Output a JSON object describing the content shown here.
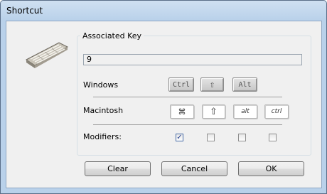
{
  "window": {
    "title": "Shortcut"
  },
  "group": {
    "label": "Associated Key"
  },
  "associated_key": {
    "value": "9"
  },
  "rows": {
    "windows": "Windows",
    "macintosh": "Macintosh",
    "modifiers": "Modifiers:"
  },
  "windows_keys": {
    "ctrl": "Ctrl",
    "shift": "⇧",
    "alt": "Alt"
  },
  "mac_keys": {
    "command": "⌘",
    "shift": "⇧",
    "option": "alt",
    "control": "ctrl"
  },
  "modifiers": [
    {
      "name": "modifier-ctrl",
      "checked": true
    },
    {
      "name": "modifier-shift",
      "checked": false
    },
    {
      "name": "modifier-alt",
      "checked": false
    },
    {
      "name": "modifier-ctrl-mac",
      "checked": false
    }
  ],
  "buttons": {
    "clear": "Clear",
    "cancel": "Cancel",
    "ok": "OK"
  }
}
